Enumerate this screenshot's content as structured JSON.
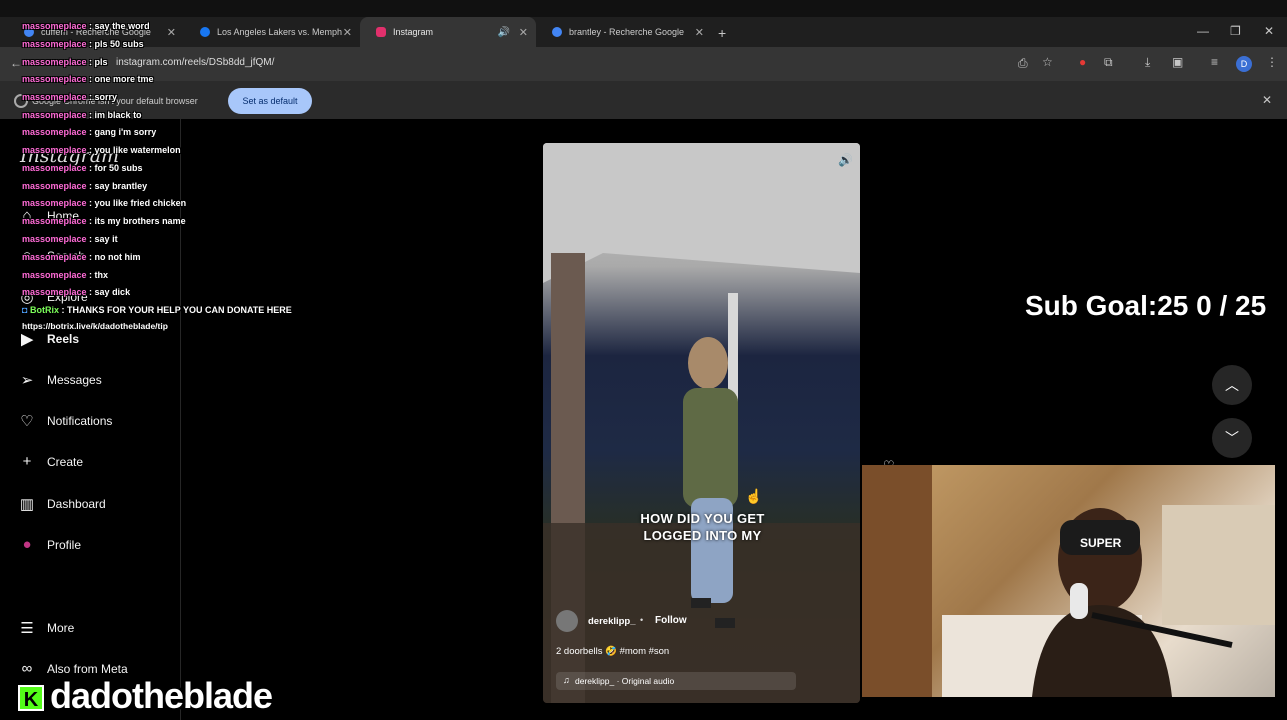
{
  "browser": {
    "tabs": [
      {
        "title": "cuffem - Recherche Google",
        "favicon_color": "#4285f4"
      },
      {
        "title": "Los Angeles Lakers vs. Memphis",
        "favicon_color": "#1877f2"
      },
      {
        "title": "Instagram",
        "favicon_color": "#e1306c"
      },
      {
        "title": "brantley - Recherche Google",
        "favicon_color": "#4285f4"
      }
    ],
    "new_tab": "+",
    "url": "instagram.com/reels/DSb8dd_jfQM/",
    "infobar_text": "Google Chrome isn't your default browser",
    "set_default_label": "Set as default",
    "profile_initial": "D"
  },
  "instagram": {
    "logo": "Instagram",
    "nav": [
      {
        "label": "Home",
        "icon": "home-icon"
      },
      {
        "label": "Search",
        "icon": "search-icon"
      },
      {
        "label": "Explore",
        "icon": "explore-icon"
      },
      {
        "label": "Reels",
        "icon": "reels-icon"
      },
      {
        "label": "Messages",
        "icon": "messages-icon"
      },
      {
        "label": "Notifications",
        "icon": "heart-icon"
      },
      {
        "label": "Create",
        "icon": "plus-icon"
      },
      {
        "label": "Dashboard",
        "icon": "dashboard-icon"
      },
      {
        "label": "Profile",
        "icon": "avatar-icon"
      },
      {
        "label": "More",
        "icon": "menu-icon"
      },
      {
        "label": "Also from Meta",
        "icon": "meta-icon"
      }
    ],
    "reel": {
      "caption_overlay": "HOW DID YOU GET LOGGED INTO MY",
      "author": "dereklipp_",
      "follow_label": "Follow",
      "description": "2 doorbells 🤣 #mom #son",
      "audio": "dereklipp_ · Original audio"
    }
  },
  "stream": {
    "sub_goal": "Sub Goal:25  0 / 25",
    "channel_name": "dadotheblade",
    "kick_logo": "K",
    "chat": [
      {
        "user": "massomeplace",
        "msg": "say the word"
      },
      {
        "user": "massomeplace",
        "msg": "pls 50 subs"
      },
      {
        "user": "massomeplace",
        "msg": "pls"
      },
      {
        "user": "massomeplace",
        "msg": "one more tme"
      },
      {
        "user": "massomeplace",
        "msg": "sorry"
      },
      {
        "user": "massomeplace",
        "msg": "im black to"
      },
      {
        "user": "massomeplace",
        "msg": "gang i'm sorry"
      },
      {
        "user": "massomeplace",
        "msg": "you like watermelon"
      },
      {
        "user": "massomeplace",
        "msg": "for 50 subs"
      },
      {
        "user": "massomeplace",
        "msg": "say brantley"
      },
      {
        "user": "massomeplace",
        "msg": "you like fried chicken"
      },
      {
        "user": "massomeplace",
        "msg": "its my brothers name"
      },
      {
        "user": "massomeplace",
        "msg": "say it"
      },
      {
        "user": "massomeplace",
        "msg": "no not him"
      },
      {
        "user": "massomeplace",
        "msg": "thx"
      },
      {
        "user": "massomeplace",
        "msg": "say dick"
      }
    ],
    "bot_message": {
      "user": "BotRix",
      "msg": "THANKS FOR YOUR HELP YOU CAN DONATE HERE"
    },
    "donate_link": "https://botrix.live/k/dadotheblade/tip"
  }
}
